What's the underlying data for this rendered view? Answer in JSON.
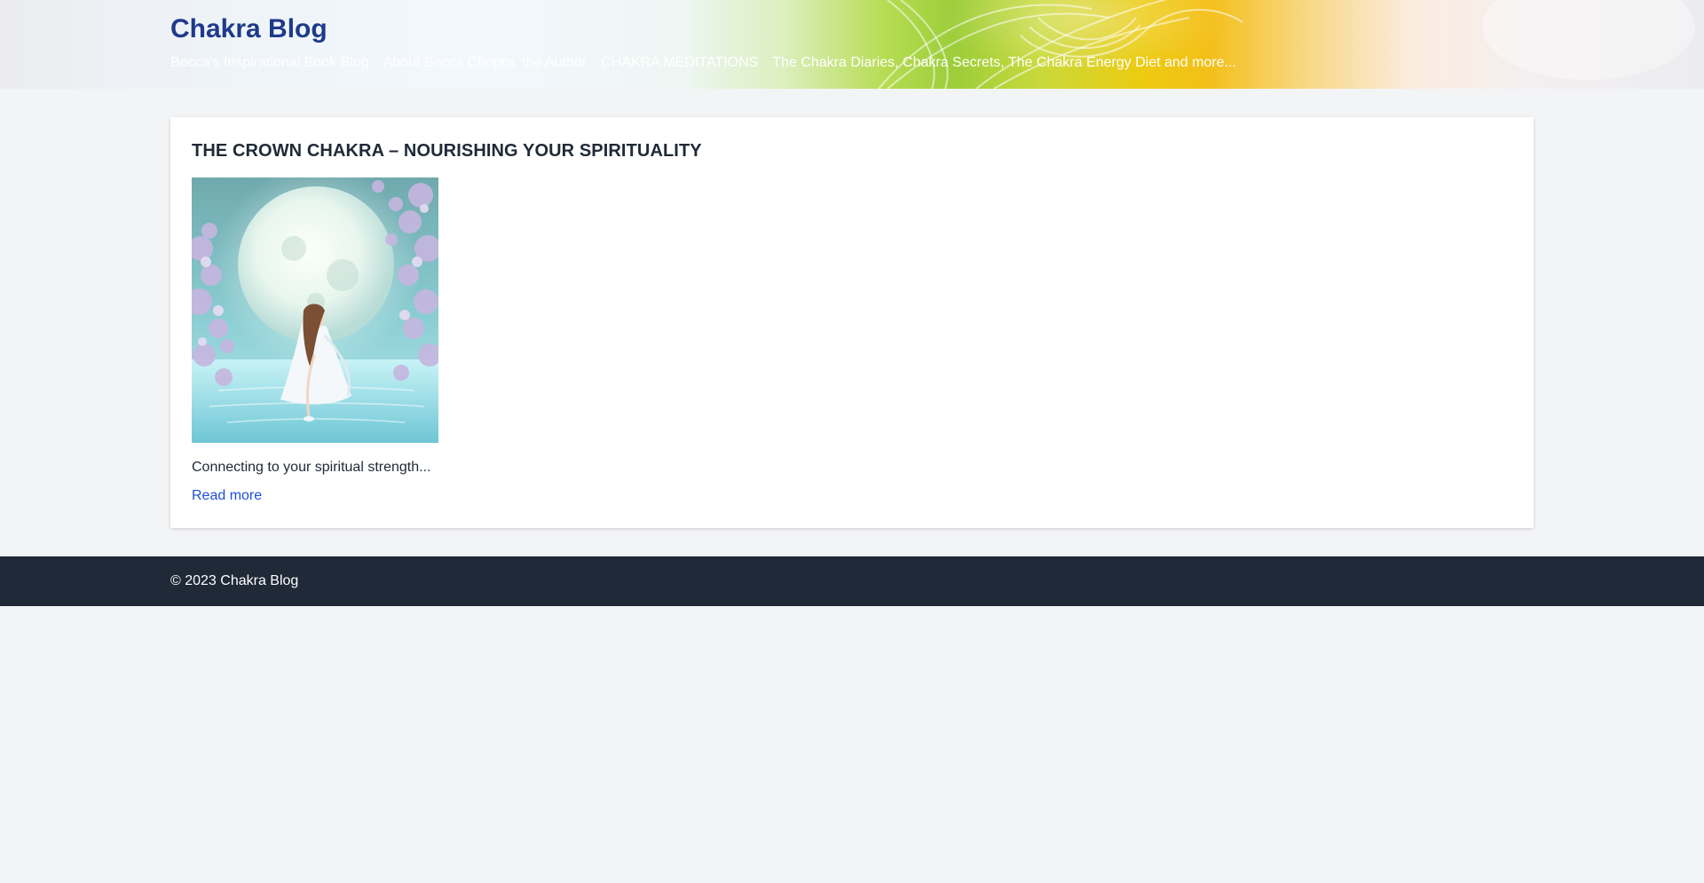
{
  "site": {
    "title": "Chakra Blog",
    "nav": [
      "Becca's Inspirational Book Blog",
      "About Becca Chopra, the Author",
      "CHAKRA MEDITATIONS",
      "The Chakra Diaries, Chakra Secrets, The Chakra Energy Diet and more..."
    ]
  },
  "post": {
    "title": "THE CROWN CHAKRA – NOURISHING YOUR SPIRITUALITY",
    "image_alt": "",
    "excerpt": "Connecting to your spiritual strength...",
    "read_more": "Read more"
  },
  "footer": {
    "text": "© 2023 Chakra Blog"
  },
  "colors": {
    "title_blue": "#1e3a8a",
    "link_blue": "#1d4ed8",
    "footer_bg": "#1f2937",
    "page_bg": "#f3f4f6"
  }
}
